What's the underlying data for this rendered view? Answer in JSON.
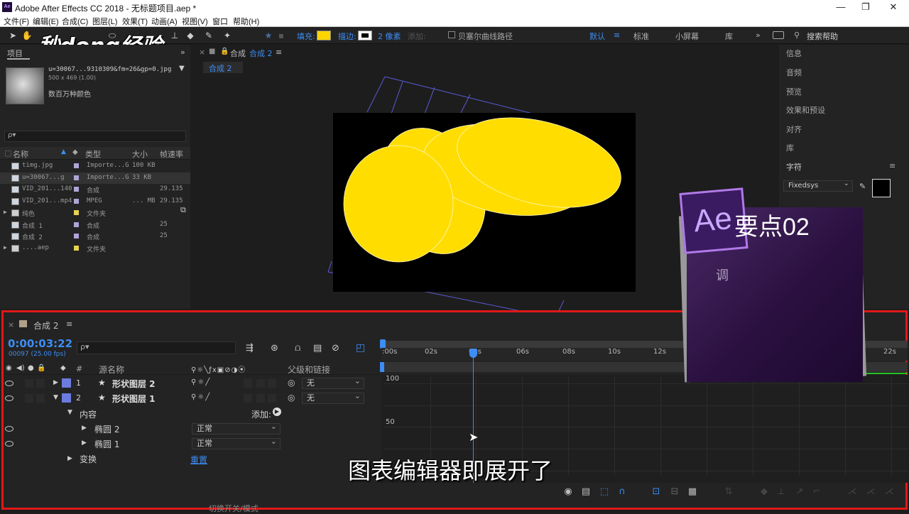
{
  "window": {
    "app_icon": "Ae",
    "title": "Adobe After Effects CC 2018 - 无标题项目.aep *",
    "min": "—",
    "max": "❐",
    "close": "✕"
  },
  "menu": [
    "文件(F)",
    "编辑(E)",
    "合成(C)",
    "图层(L)",
    "效果(T)",
    "动画(A)",
    "视图(V)",
    "窗口",
    "帮助(H)"
  ],
  "toolbar": {
    "fill_label": "填充:",
    "stroke_label": "描边:",
    "stroke_width": "2 像素",
    "add_label": "添加:",
    "bezier_label": "贝塞尔曲线路径",
    "fill_color": "#ffd500",
    "workspaces": [
      "默认",
      "标准",
      "小屏幕",
      "库"
    ],
    "active_workspace_color": "#3d8df5",
    "search_placeholder": "搜索帮助"
  },
  "watermark": {
    "text": "秒dong经验"
  },
  "project": {
    "tab": "项目",
    "file_name": "u=30067...9310309&fm=26&gp=0.jpg",
    "file_dims": "500 x 469 (1.00)",
    "file_desc": "数百万种颜色",
    "search_placeholder": "ρ▾",
    "columns": {
      "name": "名称",
      "type": "类型",
      "size": "大小",
      "fps": "帧速率"
    },
    "items": [
      {
        "name": "timg.jpg",
        "type": "Importe...G",
        "size": "100 KB",
        "fps": "",
        "swatch": "#b0a4d8",
        "kind": "image"
      },
      {
        "name": "u=30067...g",
        "type": "Importe...G",
        "size": "33 KB",
        "fps": "",
        "swatch": "#b0a4d8",
        "kind": "image"
      },
      {
        "name": "VID_201...140",
        "type": "合成",
        "size": "",
        "fps": "29.135",
        "swatch": "#b0a4d8",
        "kind": "comp"
      },
      {
        "name": "VID_201...mp4",
        "type": "MPEG",
        "size": "... MB",
        "fps": "29.135",
        "swatch": "#b0a4d8",
        "kind": "video"
      },
      {
        "name": "纯色",
        "type": "文件夹",
        "size": "",
        "fps": "",
        "swatch": "#e8d250",
        "kind": "folder"
      },
      {
        "name": "合成 1",
        "type": "合成",
        "size": "",
        "fps": "25",
        "swatch": "#b0a4d8",
        "kind": "comp"
      },
      {
        "name": "合成 2",
        "type": "合成",
        "size": "",
        "fps": "25",
        "swatch": "#b0a4d8",
        "kind": "comp"
      },
      {
        "name": "....aep",
        "type": "文件夹",
        "size": "",
        "fps": "",
        "swatch": "#e8d250",
        "kind": "folder"
      }
    ]
  },
  "composition": {
    "panel_title": "合成",
    "comp_name": "合成 2",
    "breadcrumb": "合成 2"
  },
  "right_panel": {
    "items": [
      "信息",
      "音频",
      "预览",
      "效果和预设",
      "对齐",
      "库",
      "字符"
    ],
    "font": "Fixedsys"
  },
  "overlay": {
    "logo": "Ae",
    "title": "要点02",
    "subtitle": "调"
  },
  "timeline": {
    "comp_tab": "合成 2",
    "timecode": "0:00:03:22",
    "frame_info": "00097 (25.00 fps)",
    "search_placeholder": "ρ▾",
    "columns": {
      "num": "#",
      "source": "源名称",
      "parent": "父级和链接"
    },
    "layers": [
      {
        "num": "1",
        "name": "形状图层 2",
        "parent": "无",
        "color": "#6c7be0",
        "expanded": false
      },
      {
        "num": "2",
        "name": "形状图层 1",
        "parent": "无",
        "color": "#6c7be0",
        "expanded": true
      }
    ],
    "content_label": "内容",
    "add_label": "添加:",
    "sublayers": [
      {
        "name": "椭圆 2",
        "mode": "正常"
      },
      {
        "name": "椭圆 1",
        "mode": "正常"
      }
    ],
    "transform_label": "变换",
    "reset_label": "重置",
    "ruler_ticks": [
      ":00s",
      "02s",
      "04s",
      "06s",
      "08s",
      "10s",
      "12s",
      "22s"
    ],
    "graph_labels": [
      "100",
      "50"
    ],
    "bottom_label": "切换开关/模式"
  },
  "caption": "图表编辑器即展开了",
  "highlight_color": "#e01818"
}
